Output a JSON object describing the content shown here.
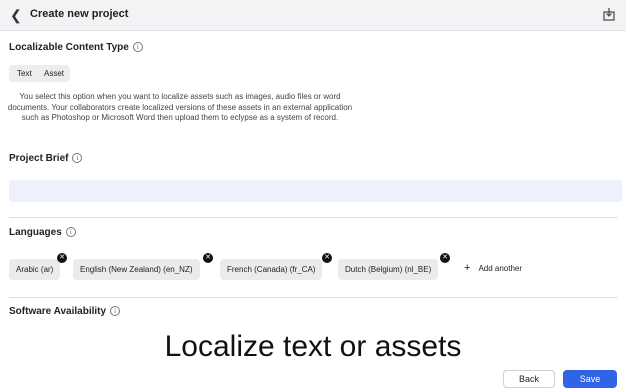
{
  "header": {
    "title": "Create new project",
    "back_icon": "chevron-left-icon",
    "export_icon": "share-icon"
  },
  "content_type": {
    "label": "Localizable Content Type",
    "options": [
      "Text",
      "Asset"
    ],
    "selected": "Asset",
    "description": "You select this option when you want to localize assets such as images, audio files or word documents. Your collaborators create localized versions of these assets in an external application such as Photoshop or Microsoft Word then upload them to eclypse as a system of record."
  },
  "brief": {
    "label": "Project Brief",
    "value": ""
  },
  "languages": {
    "label": "Languages",
    "chips": [
      "Arabic (ar)",
      "English (New Zealand) (en_NZ)",
      "French (Canada) (fr_CA)",
      "Dutch (Belgium) (nl_BE)"
    ],
    "add_label": "Add another"
  },
  "software": {
    "label": "Software Availability"
  },
  "caption": "Localize text or assets",
  "footer": {
    "back_label": "Back",
    "save_label": "Save",
    "save_color": "#2f64e6"
  }
}
